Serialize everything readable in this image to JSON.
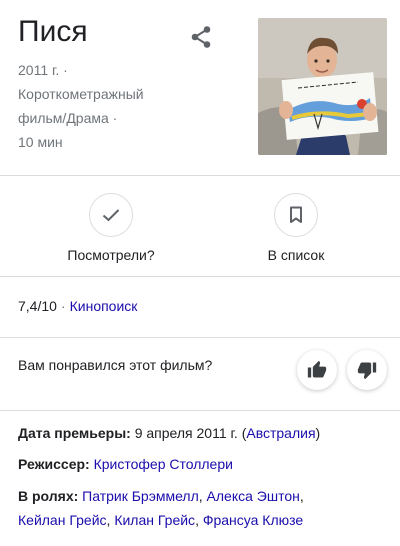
{
  "title": "Пися",
  "meta": {
    "year": "2011 г. ·",
    "genre_line1": "Короткометражный",
    "genre_line2": "фильм/Драма ·",
    "duration": "10 мин"
  },
  "icons": {
    "share": "share-icon",
    "watched": "checkmark-icon",
    "watchlist": "bookmark-icon",
    "like": "thumbs-up-icon",
    "dislike": "thumbs-down-icon"
  },
  "actions": {
    "watched_label": "Посмотрели?",
    "watchlist_label": "В список"
  },
  "rating": {
    "score": "7,4/10",
    "separator": "·",
    "source": "Кинопоиск"
  },
  "feedback": {
    "question": "Вам понравился этот фильм?"
  },
  "facts": {
    "premiere_label": "Дата премьеры:",
    "premiere_date": "9 апреля 2011 г.",
    "premiere_country": "Австралия",
    "director_label": "Режиссер:",
    "director": "Кристофер Столлери",
    "cast_label": "В ролях:",
    "cast": [
      "Патрик Брэммелл",
      "Алекса Эштон",
      "Кейлан Грейс",
      "Килан Грейс",
      "Франсуа Клюзе"
    ]
  },
  "colors": {
    "link": "#1a0dab",
    "secondary_text": "#70757a",
    "divider": "#dadce0"
  }
}
